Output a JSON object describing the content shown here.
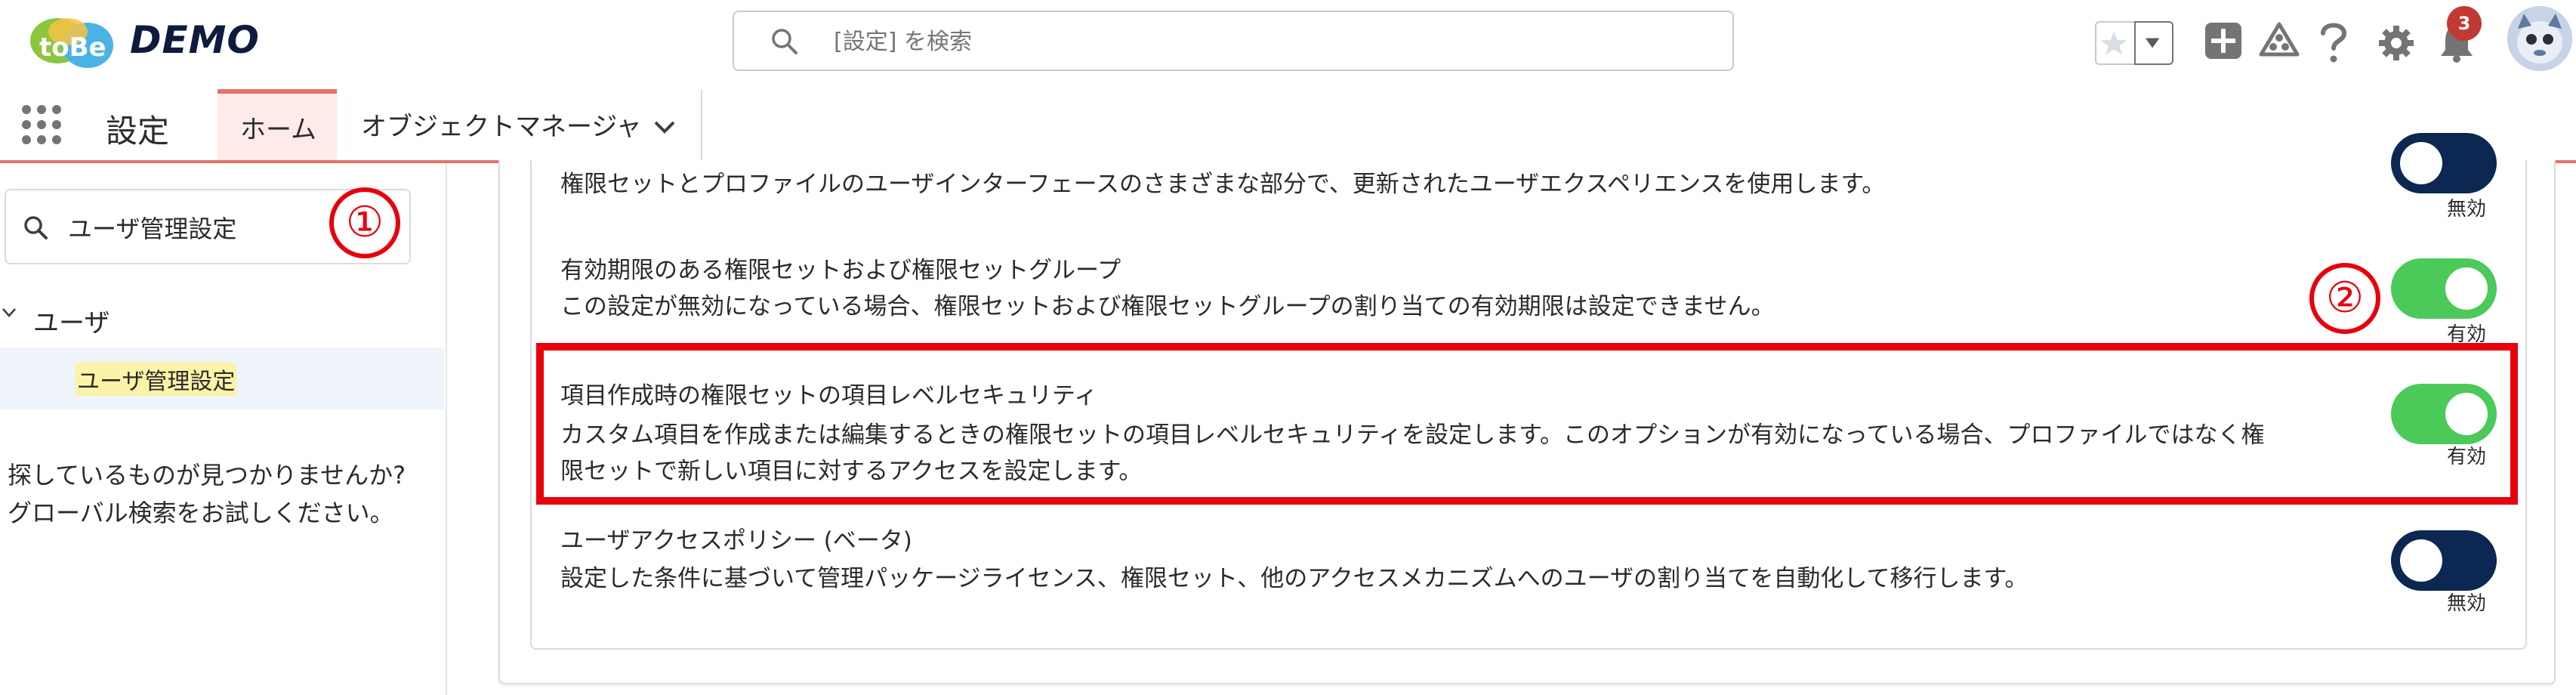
{
  "header": {
    "logo_text": "toBe",
    "org_name": "DEMO",
    "search_placeholder": "[設定] を検索",
    "notification_count": "3"
  },
  "nav": {
    "app_name": "設定",
    "tabs": [
      {
        "label": "ホーム",
        "active": true
      },
      {
        "label": "オブジェクトマネージャ",
        "active": false
      }
    ]
  },
  "sidebar": {
    "quickfind_value": "ユーザ管理設定",
    "callout_1": "①",
    "tree": {
      "group_label": "ユーザ",
      "item_label": "ユーザ管理設定"
    },
    "not_found_line1": "探しているものが見つかりませんか?",
    "not_found_line2": "グローバル検索をお試しください。"
  },
  "settings": [
    {
      "title": "",
      "description": "権限セットとプロファイルのユーザインターフェースのさまざまな部分で、更新されたユーザエクスペリエンスを使用します。",
      "enabled": false,
      "status": "無効"
    },
    {
      "title": "有効期限のある権限セットおよび権限セットグループ",
      "description": "この設定が無効になっている場合、権限セットおよび権限セットグループの割り当ての有効期限は設定できません。",
      "enabled": true,
      "status": "有効"
    },
    {
      "title": "項目作成時の権限セットの項目レベルセキュリティ",
      "description_line1": "カスタム項目を作成または編集するときの権限セットの項目レベルセキュリティを設定します。このオプションが有効になっている場合、プロファイルではなく権",
      "description_line2": "限セットで新しい項目に対するアクセスを設定します。",
      "enabled": true,
      "status": "有効"
    },
    {
      "title": "ユーザアクセスポリシー (ベータ)",
      "description": "設定した条件に基づいて管理パッケージライセンス、権限セット、他のアクセスメカニズムへのユーザの割り当てを自動化して移行します。",
      "enabled": false,
      "status": "無効"
    }
  ],
  "callout_2": "②",
  "colors": {
    "toggle_on": "#4bca5a",
    "toggle_off": "#0b2752",
    "highlight": "#e8000b",
    "nav_accent": "#e5736a"
  }
}
